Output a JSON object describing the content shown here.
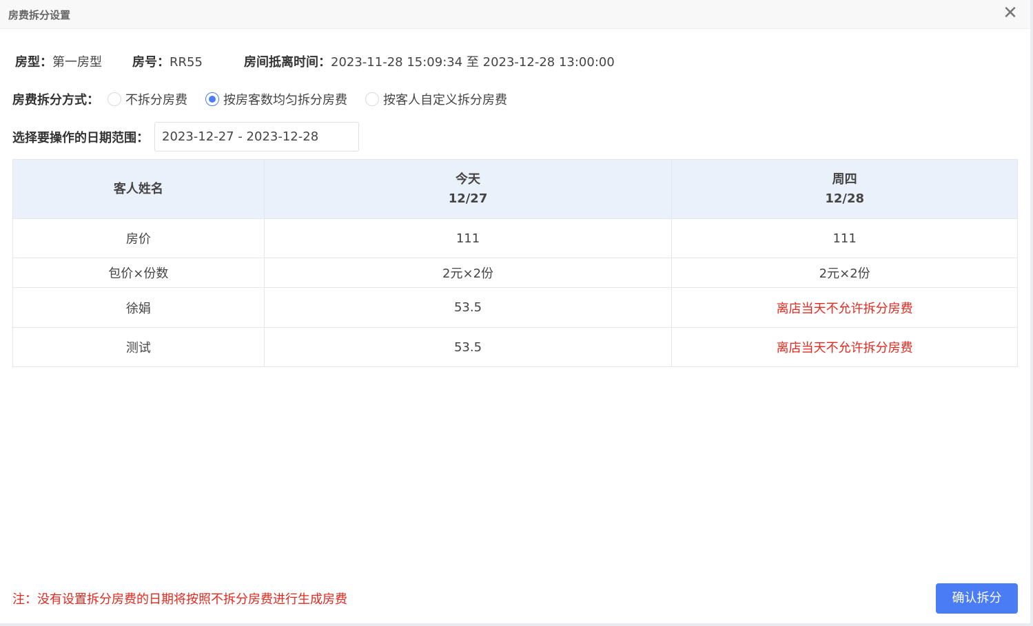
{
  "dialog": {
    "title": "房费拆分设置",
    "close_symbol": "✕"
  },
  "room_info": {
    "type_label": "房型：",
    "type_value": "第一房型",
    "number_label": "房号：",
    "number_value": "RR55",
    "stay_label": "房间抵离时间：",
    "stay_value": "2023-11-28 15:09:34 至 2023-12-28 13:00:00"
  },
  "split_mode": {
    "label": "房费拆分方式：",
    "options": [
      {
        "label": "不拆分房费",
        "checked": false
      },
      {
        "label": "按房客数均匀拆分房费",
        "checked": true
      },
      {
        "label": "按客人自定义拆分房费",
        "checked": false
      }
    ]
  },
  "date_range": {
    "label": "选择要操作的日期范围：",
    "value": "2023-12-27 - 2023-12-28"
  },
  "table": {
    "header_name": "客人姓名",
    "columns": [
      {
        "day": "今天",
        "date": "12/27"
      },
      {
        "day": "周四",
        "date": "12/28"
      }
    ],
    "rows": [
      {
        "name": "房价",
        "values": [
          "111",
          "111"
        ]
      },
      {
        "name": "包价×份数",
        "values": [
          "2元×2份",
          "2元×2份"
        ]
      },
      {
        "name": "徐娟",
        "values": [
          "53.5",
          "离店当天不允许拆分房费"
        ]
      },
      {
        "name": "测试",
        "values": [
          "53.5",
          "离店当天不允许拆分房费"
        ]
      }
    ]
  },
  "footer": {
    "note": "注：没有设置拆分房费的日期将按照不拆分房费进行生成房费",
    "confirm_label": "确认拆分"
  },
  "colors": {
    "accent": "#4a7cf5",
    "warning": "#e5281e",
    "header_bg": "#ebf1fa"
  }
}
